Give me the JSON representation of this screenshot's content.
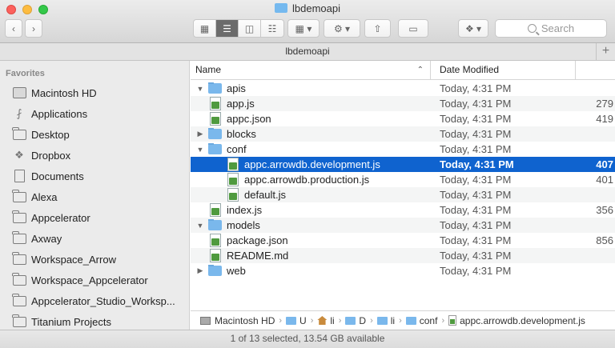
{
  "window": {
    "title": "lbdemoapi"
  },
  "toolbar": {
    "view_icons": [
      "icon-view",
      "list-view",
      "column-view",
      "coverflow-view"
    ],
    "search_placeholder": "Search"
  },
  "tabbar": {
    "title": "lbdemoapi",
    "add": "+"
  },
  "sidebar": {
    "heading": "Favorites",
    "items": [
      {
        "label": "Macintosh HD",
        "icon": "hard-drive-icon"
      },
      {
        "label": "Applications",
        "icon": "applications-icon"
      },
      {
        "label": "Desktop",
        "icon": "desktop-icon"
      },
      {
        "label": "Dropbox",
        "icon": "dropbox-icon"
      },
      {
        "label": "Documents",
        "icon": "documents-icon"
      },
      {
        "label": "Alexa",
        "icon": "folder-icon"
      },
      {
        "label": "Appcelerator",
        "icon": "folder-icon"
      },
      {
        "label": "Axway",
        "icon": "folder-icon"
      },
      {
        "label": "Workspace_Arrow",
        "icon": "folder-icon"
      },
      {
        "label": "Workspace_Appcelerator",
        "icon": "folder-icon"
      },
      {
        "label": "Appcelerator_Studio_Worksp...",
        "icon": "folder-icon"
      },
      {
        "label": "Titanium Projects",
        "icon": "folder-icon"
      }
    ]
  },
  "list": {
    "col_name": "Name",
    "col_date": "Date Modified",
    "rows": [
      {
        "name": "apis",
        "date": "Today, 4:31 PM",
        "size": "",
        "type": "folder",
        "disc": "▼",
        "indent": 0
      },
      {
        "name": "app.js",
        "date": "Today, 4:31 PM",
        "size": "279",
        "type": "file",
        "disc": "",
        "indent": 0
      },
      {
        "name": "appc.json",
        "date": "Today, 4:31 PM",
        "size": "419",
        "type": "file",
        "disc": "",
        "indent": 0
      },
      {
        "name": "blocks",
        "date": "Today, 4:31 PM",
        "size": "",
        "type": "folder",
        "disc": "▶",
        "indent": 0
      },
      {
        "name": "conf",
        "date": "Today, 4:31 PM",
        "size": "",
        "type": "folder",
        "disc": "▼",
        "indent": 0
      },
      {
        "name": "appc.arrowdb.development.js",
        "date": "Today, 4:31 PM",
        "size": "407",
        "type": "file",
        "disc": "",
        "indent": 1,
        "selected": true
      },
      {
        "name": "appc.arrowdb.production.js",
        "date": "Today, 4:31 PM",
        "size": "401",
        "type": "file",
        "disc": "",
        "indent": 1
      },
      {
        "name": "default.js",
        "date": "Today, 4:31 PM",
        "size": "",
        "type": "file",
        "disc": "",
        "indent": 1
      },
      {
        "name": "index.js",
        "date": "Today, 4:31 PM",
        "size": "356",
        "type": "file",
        "disc": "",
        "indent": 0
      },
      {
        "name": "models",
        "date": "Today, 4:31 PM",
        "size": "",
        "type": "folder",
        "disc": "▼",
        "indent": 0
      },
      {
        "name": "package.json",
        "date": "Today, 4:31 PM",
        "size": "856",
        "type": "file",
        "disc": "",
        "indent": 0
      },
      {
        "name": "README.md",
        "date": "Today, 4:31 PM",
        "size": "",
        "type": "file",
        "disc": "",
        "indent": 0
      },
      {
        "name": "web",
        "date": "Today, 4:31 PM",
        "size": "",
        "type": "folder",
        "disc": "▶",
        "indent": 0
      }
    ]
  },
  "pathbar": {
    "hd": "Macintosh HD",
    "u": "U",
    "i": "li",
    "d": "D",
    "l": "li",
    "conf": "conf",
    "file": "appc.arrowdb.development.js",
    "sep": "›"
  },
  "status": {
    "text": "1 of 13 selected, 13.54 GB available"
  },
  "colors": {
    "selection": "#0f63cf",
    "folder": "#7ab8ec"
  }
}
